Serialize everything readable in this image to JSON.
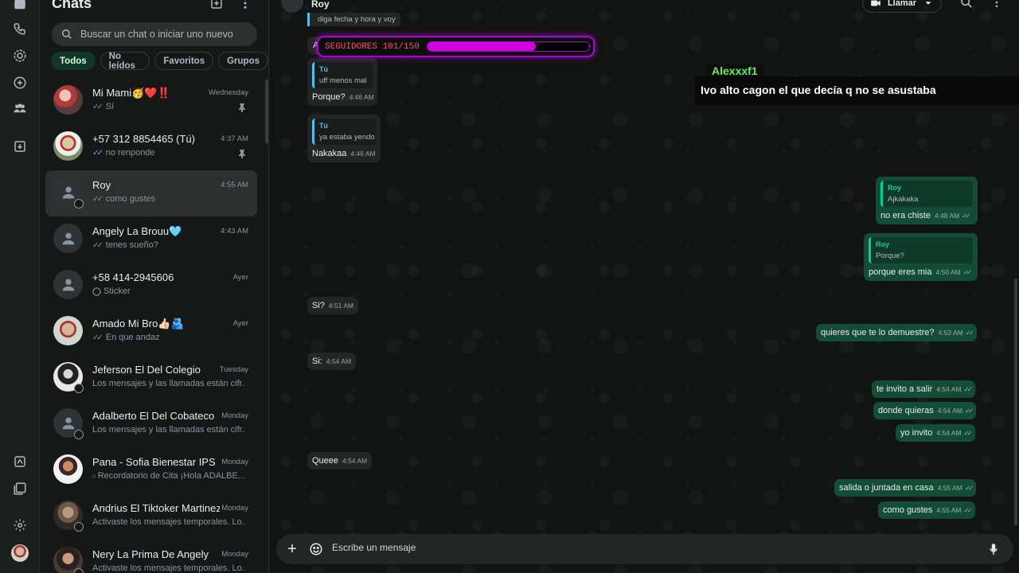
{
  "sidebar": {
    "title": "Chats",
    "search_placeholder": "Buscar un chat o iniciar uno nuevo",
    "filters": [
      "Todos",
      "No leídos",
      "Favoritos",
      "Grupos"
    ],
    "chats": [
      {
        "name": "Mi Mami🥳❤️‼️",
        "time": "Wednesday",
        "preview": "Sí",
        "ticks": "✓✓",
        "pinned": true
      },
      {
        "name": "+57 312 8854465 (Tú)",
        "time": "4:37 AM",
        "preview": "no renponde",
        "ticks": "✓✓",
        "pinned": true
      },
      {
        "name": "Roy",
        "time": "4:55 AM",
        "preview": "como gustes",
        "ticks": "✓✓"
      },
      {
        "name": "Angely La Brouu🩵",
        "time": "4:43 AM",
        "preview": "tenes sueño?",
        "ticks": "✓✓"
      },
      {
        "name": "+58 414-2945606",
        "time": "Ayer",
        "preview": "Sticker"
      },
      {
        "name": "Amado Mi Bro👍🏻🫂",
        "time": "Ayer",
        "preview": "En que andaz",
        "ticks": "✓✓"
      },
      {
        "name": "Jeferson El Del Colegio",
        "time": "Tuesday",
        "preview": "Los mensajes y las llamadas están cifr..."
      },
      {
        "name": "Adalberto El Del Cobateco",
        "time": "Monday",
        "preview": "Los mensajes y las llamadas están cifr..."
      },
      {
        "name": "Pana - Sofia Bienestar IPS",
        "time": "Monday",
        "preview": "Recordatorio de Cita ¡Hola ADALBE..."
      },
      {
        "name": "Andrius El Tiktoker Martinez",
        "time": "Monday",
        "preview": "Activaste los mensajes temporales. Lo..."
      },
      {
        "name": "Nery La Prima De Angely",
        "time": "Monday",
        "preview": "Activaste los mensajes temporales. Lo..."
      }
    ]
  },
  "conversation": {
    "contact_name": "Roy",
    "call_label": "Llamar",
    "messages_in": [
      {
        "text": "diga fecha y hora y voy"
      },
      {
        "text": "A"
      },
      {
        "quote_name": "Tú",
        "quote_text": "uff menos mal",
        "text": "Porque?",
        "time": "4:46 AM"
      },
      {
        "quote_name": "Tú",
        "quote_text": "ya estaba yendo",
        "text": "Nakakaa",
        "time": "4:46 AM"
      },
      {
        "text": "Si?",
        "time": "4:51 AM"
      },
      {
        "text": "Si:",
        "time": "4:54 AM"
      },
      {
        "text": "Queee",
        "time": "4:54 AM"
      }
    ],
    "messages_out": [
      {
        "quote_name": "Roy",
        "quote_text": "Ajkakaka",
        "text": "no era chiste",
        "time": "4:48 AM"
      },
      {
        "quote_name": "Roy",
        "quote_text": "Porque?",
        "text": "porque eres mia",
        "time": "4:50 AM"
      },
      {
        "text": "quieres que te lo demuestre?",
        "time": "4:53 AM"
      },
      {
        "text": "te invito a salir",
        "time": "4:54 AM"
      },
      {
        "text": "donde quieras",
        "time": "4:54 AM"
      },
      {
        "text": "yo invito",
        "time": "4:54 AM"
      },
      {
        "text": "salida o juntada en casa",
        "time": "4:55 AM"
      },
      {
        "text": "como gustes",
        "time": "4:55 AM"
      }
    ],
    "composer_placeholder": "Escribe un mensaje"
  },
  "overlay": {
    "followers_label": "SEGUIDORES 101/150",
    "followers_progress": 0.67,
    "username": "Alexxxf1",
    "comment": "Ivo alto cagon el que decía q no se asustaba"
  },
  "colors": {
    "bg": "#161717",
    "bubble_in": "#242626",
    "bubble_out": "#144d37",
    "accent": "#06cf9c",
    "read_ticks": "#53bdeb",
    "overlay_purple": "#d000e0"
  }
}
